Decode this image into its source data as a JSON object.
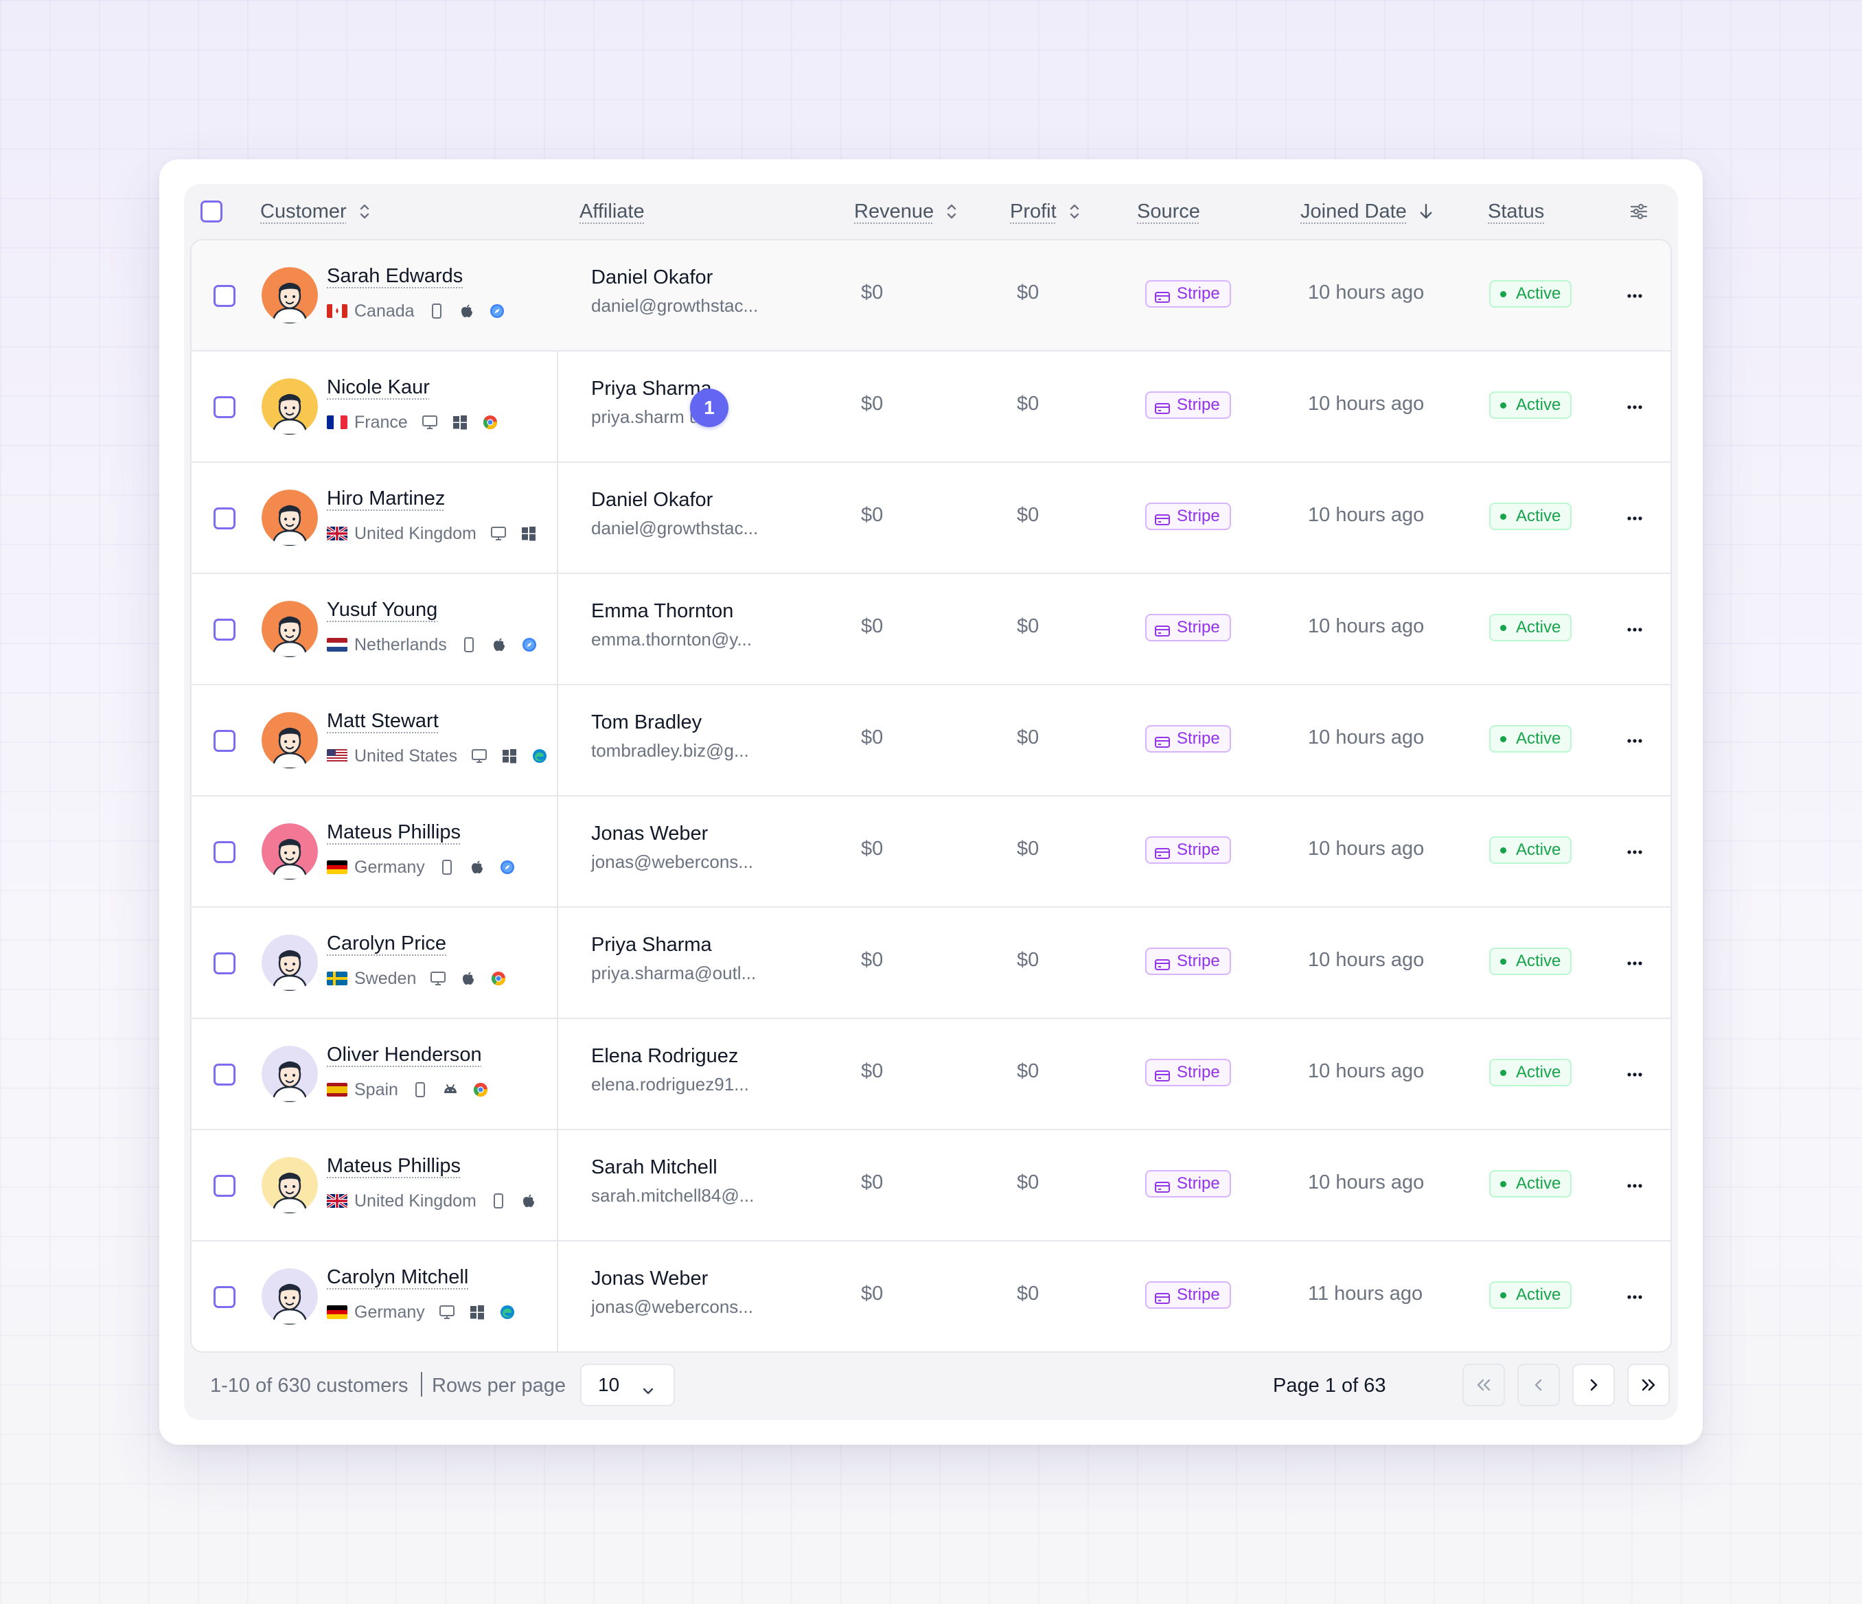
{
  "table": {
    "columns": {
      "customer": "Customer",
      "affiliate": "Affiliate",
      "revenue": "Revenue",
      "profit": "Profit",
      "source": "Source",
      "joined_date": "Joined Date",
      "status": "Status"
    },
    "rows": [
      {
        "name": "Sarah Edwards",
        "country": "Canada",
        "affiliate_name": "Daniel Okafor",
        "affiliate_email": "daniel@growthstac...",
        "revenue": "$0",
        "profit": "$0",
        "source": "Stripe",
        "joined": "10 hours ago",
        "status": "Active"
      },
      {
        "name": "Nicole Kaur",
        "country": "France",
        "affiliate_name": "Priya Sharma",
        "affiliate_email": "priya.sharm   utl...",
        "revenue": "$0",
        "profit": "$0",
        "source": "Stripe",
        "joined": "10 hours ago",
        "status": "Active"
      },
      {
        "name": "Hiro Martinez",
        "country": "United Kingdom",
        "affiliate_name": "Daniel Okafor",
        "affiliate_email": "daniel@growthstac...",
        "revenue": "$0",
        "profit": "$0",
        "source": "Stripe",
        "joined": "10 hours ago",
        "status": "Active"
      },
      {
        "name": "Yusuf Young",
        "country": "Netherlands",
        "affiliate_name": "Emma Thornton",
        "affiliate_email": "emma.thornton@y...",
        "revenue": "$0",
        "profit": "$0",
        "source": "Stripe",
        "joined": "10 hours ago",
        "status": "Active"
      },
      {
        "name": "Matt Stewart",
        "country": "United States",
        "affiliate_name": "Tom Bradley",
        "affiliate_email": "tombradley.biz@g...",
        "revenue": "$0",
        "profit": "$0",
        "source": "Stripe",
        "joined": "10 hours ago",
        "status": "Active"
      },
      {
        "name": "Mateus Phillips",
        "country": "Germany",
        "affiliate_name": "Jonas Weber",
        "affiliate_email": "jonas@webercons...",
        "revenue": "$0",
        "profit": "$0",
        "source": "Stripe",
        "joined": "10 hours ago",
        "status": "Active"
      },
      {
        "name": "Carolyn Price",
        "country": "Sweden",
        "affiliate_name": "Priya Sharma",
        "affiliate_email": "priya.sharma@outl...",
        "revenue": "$0",
        "profit": "$0",
        "source": "Stripe",
        "joined": "10 hours ago",
        "status": "Active"
      },
      {
        "name": "Oliver Henderson",
        "country": "Spain",
        "affiliate_name": "Elena Rodriguez",
        "affiliate_email": "elena.rodriguez91...",
        "revenue": "$0",
        "profit": "$0",
        "source": "Stripe",
        "joined": "10 hours ago",
        "status": "Active"
      },
      {
        "name": "Mateus Phillips",
        "country": "United Kingdom",
        "affiliate_name": "Sarah Mitchell",
        "affiliate_email": "sarah.mitchell84@...",
        "revenue": "$0",
        "profit": "$0",
        "source": "Stripe",
        "joined": "10 hours ago",
        "status": "Active"
      },
      {
        "name": "Carolyn Mitchell",
        "country": "Germany",
        "affiliate_name": "Jonas Weber",
        "affiliate_email": "jonas@webercons...",
        "revenue": "$0",
        "profit": "$0",
        "source": "Stripe",
        "joined": "11 hours ago",
        "status": "Active"
      }
    ],
    "row_devices": [
      [
        "phone-icon",
        "apple-icon",
        "safari-icon"
      ],
      [
        "desktop-icon",
        "windows-icon",
        "chrome-icon"
      ],
      [
        "desktop-icon",
        "windows-icon"
      ],
      [
        "phone-icon",
        "apple-icon",
        "safari-icon"
      ],
      [
        "desktop-icon",
        "windows-icon",
        "edge-icon"
      ],
      [
        "phone-icon",
        "apple-icon",
        "safari-icon"
      ],
      [
        "desktop-icon",
        "apple-icon",
        "chrome-icon"
      ],
      [
        "phone-icon",
        "android-icon",
        "chrome-icon"
      ],
      [
        "phone-icon",
        "apple-icon"
      ],
      [
        "desktop-icon",
        "windows-icon",
        "edge-icon"
      ]
    ],
    "avatar_colors": [
      "#f4894e",
      "#f9c74f",
      "#f4894e",
      "#f4894e",
      "#f4894e",
      "#f27896",
      "#e4e1f7",
      "#e4e1f7",
      "#fbe7a7",
      "#e4e1f7"
    ],
    "cursor_badge": "1"
  },
  "footer": {
    "count": "1-10 of 630 customers",
    "rows_per_page_label": "Rows per page",
    "rows_per_page_value": "10",
    "page_label": "Page 1 of 63"
  },
  "colors": {
    "accent": "#6366f1",
    "checkbox": "#7c6cf0",
    "source_text": "#9333ea",
    "status_text": "#16a34a"
  }
}
